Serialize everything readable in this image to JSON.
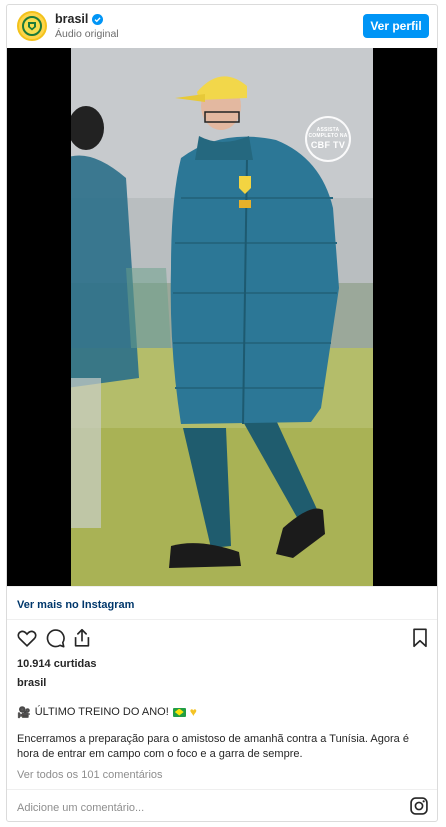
{
  "header": {
    "username": "brasil",
    "subtitle": "Áudio original",
    "profile_button": "Ver perfil"
  },
  "media": {
    "watermark_top": "ASSISTA COMPLETO NA",
    "watermark_brand": "CBF TV"
  },
  "footer": {
    "instagram_link": "Ver mais no Instagram",
    "likes": "10.914 curtidas",
    "owner": "brasil",
    "caption_title": "ÚLTIMO TREINO DO ANO!",
    "caption_body": "Encerramos a preparação para o amistoso de amanhã contra a Tunísia. Agora é hora de entrar em campo com o foco e a garra de sempre.",
    "comments_link": "Ver todos os 101 comentários",
    "comment_placeholder": "Adicione um comentário..."
  },
  "icons": [
    "verified-icon",
    "heart-icon",
    "comment-icon",
    "share-icon",
    "bookmark-icon",
    "instagram-icon",
    "movie-camera-icon",
    "brazil-flag-icon",
    "yellow-heart-icon"
  ],
  "colors": {
    "accent": "#0095f6",
    "link": "#00376b",
    "muted": "#8e8e8e"
  }
}
